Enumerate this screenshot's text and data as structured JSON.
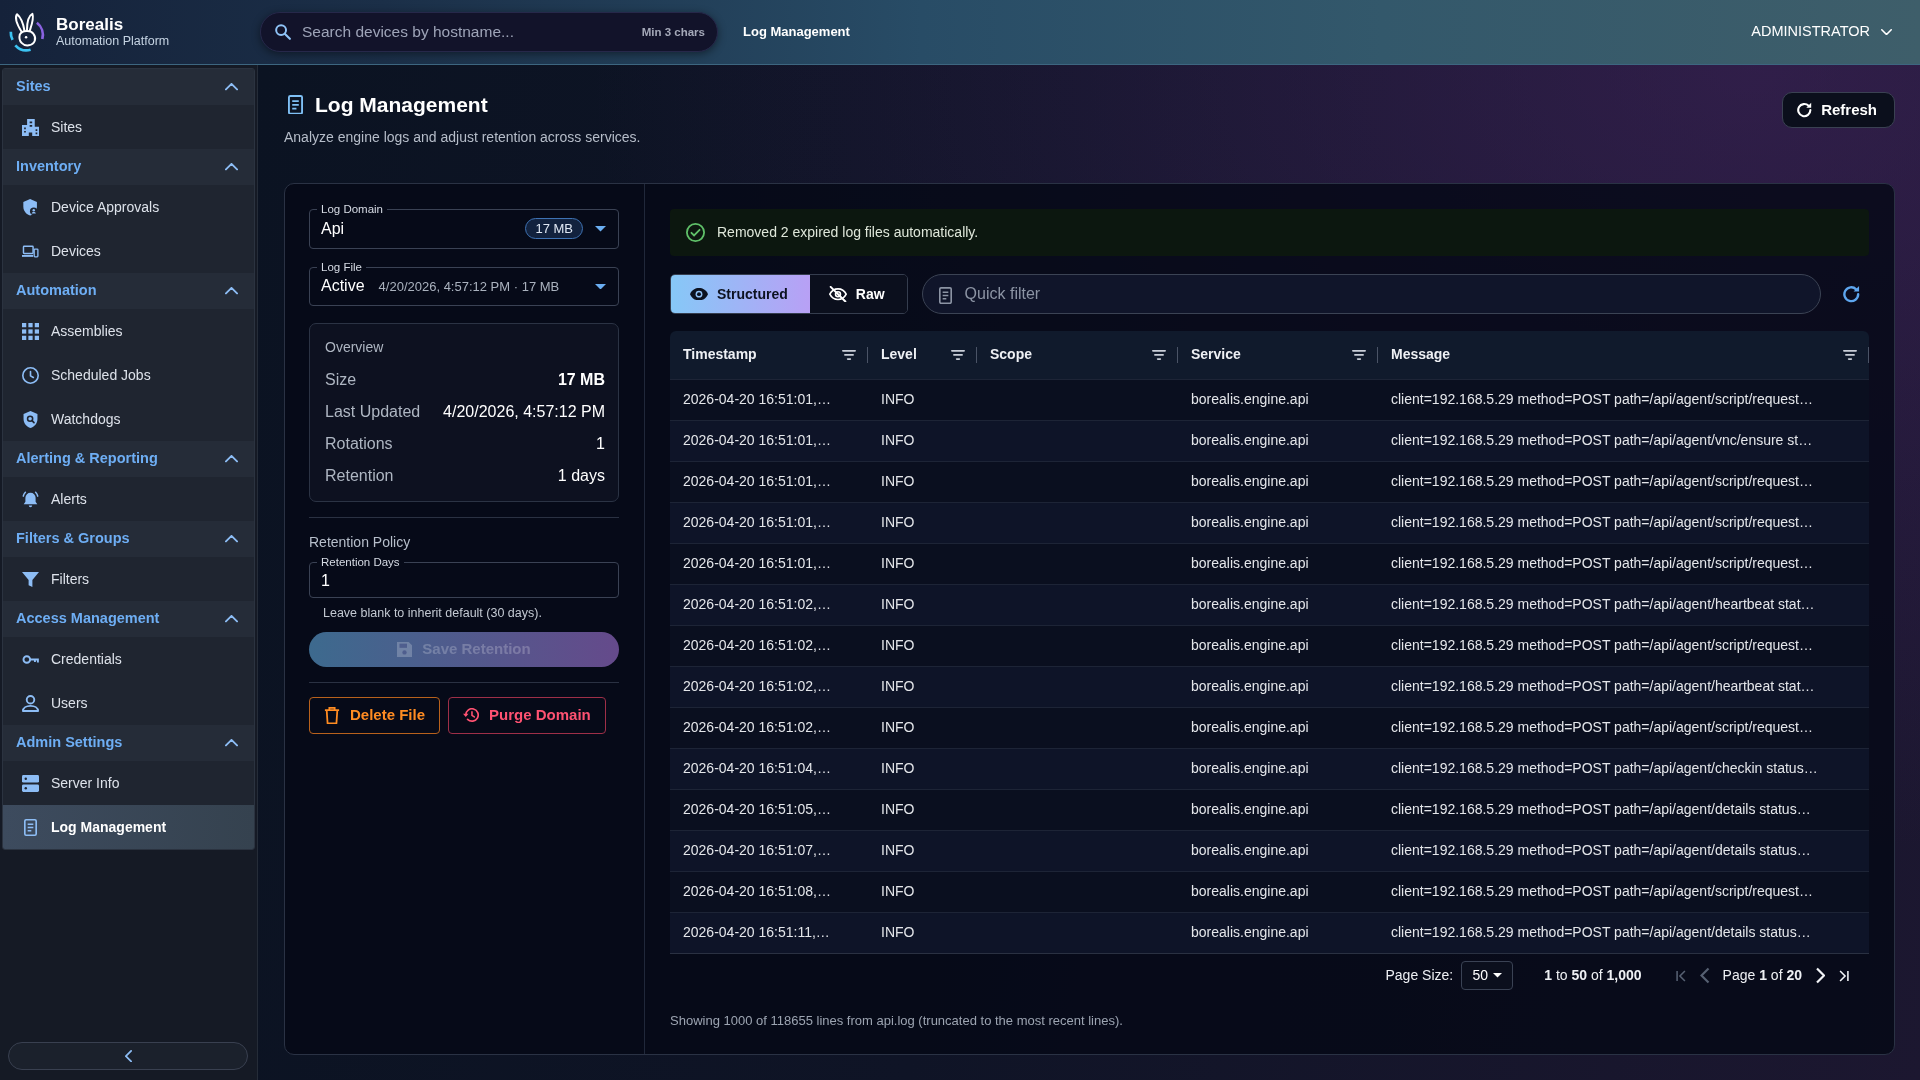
{
  "app": {
    "name": "Borealis",
    "tagline": "Automation Platform"
  },
  "search": {
    "placeholder": "Search devices by hostname...",
    "hint": "Min 3 chars"
  },
  "breadcrumb": "Log Management",
  "user_menu": "ADMINISTRATOR",
  "sidebar": {
    "sections": [
      {
        "title": "Sites",
        "expanded": true,
        "items": [
          {
            "label": "Sites",
            "selected": false
          }
        ]
      },
      {
        "title": "Inventory",
        "expanded": true,
        "items": [
          {
            "label": "Device Approvals",
            "selected": false
          },
          {
            "label": "Devices",
            "selected": false
          }
        ]
      },
      {
        "title": "Automation",
        "expanded": true,
        "items": [
          {
            "label": "Assemblies",
            "selected": false
          },
          {
            "label": "Scheduled Jobs",
            "selected": false
          },
          {
            "label": "Watchdogs",
            "selected": false
          }
        ]
      },
      {
        "title": "Alerting & Reporting",
        "expanded": true,
        "items": [
          {
            "label": "Alerts",
            "selected": false
          }
        ]
      },
      {
        "title": "Filters & Groups",
        "expanded": true,
        "items": [
          {
            "label": "Filters",
            "selected": false
          }
        ]
      },
      {
        "title": "Access Management",
        "expanded": true,
        "items": [
          {
            "label": "Credentials",
            "selected": false
          },
          {
            "label": "Users",
            "selected": false
          }
        ]
      },
      {
        "title": "Admin Settings",
        "expanded": true,
        "items": [
          {
            "label": "Server Info",
            "selected": false
          },
          {
            "label": "Log Management",
            "selected": true
          }
        ]
      }
    ]
  },
  "page": {
    "title": "Log Management",
    "subtitle": "Analyze engine logs and adjust retention across services.",
    "refresh_button": "Refresh"
  },
  "log_domain": {
    "label": "Log Domain",
    "value": "Api",
    "badge": "17 MB"
  },
  "log_file": {
    "label": "Log File",
    "value": "Active",
    "detail": "4/20/2026, 4:57:12 PM · 17 MB"
  },
  "overview": {
    "title": "Overview",
    "rows": [
      {
        "label": "Size",
        "value": "17 MB",
        "emphasized": true
      },
      {
        "label": "Last Updated",
        "value": "4/20/2026, 4:57:12 PM",
        "emphasized": false
      },
      {
        "label": "Rotations",
        "value": "1",
        "emphasized": false
      },
      {
        "label": "Retention",
        "value": "1 days",
        "emphasized": false
      }
    ]
  },
  "retention_policy": {
    "title": "Retention Policy",
    "field_label": "Retention Days",
    "value": "1",
    "help": "Leave blank to inherit default (30 days).",
    "save_button": {
      "label": "Save Retention",
      "disabled": true
    }
  },
  "file_actions": [
    {
      "label": "Delete File",
      "kind": "warning"
    },
    {
      "label": "Purge Domain",
      "kind": "danger"
    }
  ],
  "alert": {
    "kind": "success",
    "text": "Removed 2 expired log files automatically."
  },
  "view_modes": [
    {
      "label": "Structured",
      "selected": true
    },
    {
      "label": "Raw",
      "selected": false
    }
  ],
  "quick_filter": {
    "placeholder": "Quick filter"
  },
  "table": {
    "columns": [
      "Timestamp",
      "Level",
      "Scope",
      "Service",
      "Message"
    ],
    "rows": [
      {
        "timestamp": "2026-04-20 16:51:01,…",
        "level": "INFO",
        "service": "borealis.engine.api",
        "message": "client=192.168.5.29 method=POST path=/api/agent/script/request…"
      },
      {
        "timestamp": "2026-04-20 16:51:01,…",
        "level": "INFO",
        "service": "borealis.engine.api",
        "message": "client=192.168.5.29 method=POST path=/api/agent/vnc/ensure st…"
      },
      {
        "timestamp": "2026-04-20 16:51:01,…",
        "level": "INFO",
        "service": "borealis.engine.api",
        "message": "client=192.168.5.29 method=POST path=/api/agent/script/request…"
      },
      {
        "timestamp": "2026-04-20 16:51:01,…",
        "level": "INFO",
        "service": "borealis.engine.api",
        "message": "client=192.168.5.29 method=POST path=/api/agent/script/request…"
      },
      {
        "timestamp": "2026-04-20 16:51:01,…",
        "level": "INFO",
        "service": "borealis.engine.api",
        "message": "client=192.168.5.29 method=POST path=/api/agent/script/request…"
      },
      {
        "timestamp": "2026-04-20 16:51:02,…",
        "level": "INFO",
        "service": "borealis.engine.api",
        "message": "client=192.168.5.29 method=POST path=/api/agent/heartbeat stat…"
      },
      {
        "timestamp": "2026-04-20 16:51:02,…",
        "level": "INFO",
        "service": "borealis.engine.api",
        "message": "client=192.168.5.29 method=POST path=/api/agent/script/request…"
      },
      {
        "timestamp": "2026-04-20 16:51:02,…",
        "level": "INFO",
        "service": "borealis.engine.api",
        "message": "client=192.168.5.29 method=POST path=/api/agent/heartbeat stat…"
      },
      {
        "timestamp": "2026-04-20 16:51:02,…",
        "level": "INFO",
        "service": "borealis.engine.api",
        "message": "client=192.168.5.29 method=POST path=/api/agent/script/request…"
      },
      {
        "timestamp": "2026-04-20 16:51:04,…",
        "level": "INFO",
        "service": "borealis.engine.api",
        "message": "client=192.168.5.29 method=POST path=/api/agent/checkin status…"
      },
      {
        "timestamp": "2026-04-20 16:51:05,…",
        "level": "INFO",
        "service": "borealis.engine.api",
        "message": "client=192.168.5.29 method=POST path=/api/agent/details status…"
      },
      {
        "timestamp": "2026-04-20 16:51:07,…",
        "level": "INFO",
        "service": "borealis.engine.api",
        "message": "client=192.168.5.29 method=POST path=/api/agent/details status…"
      },
      {
        "timestamp": "2026-04-20 16:51:08,…",
        "level": "INFO",
        "service": "borealis.engine.api",
        "message": "client=192.168.5.29 method=POST path=/api/agent/script/request…"
      },
      {
        "timestamp": "2026-04-20 16:51:11,…",
        "level": "INFO",
        "service": "borealis.engine.api",
        "message": "client=192.168.5.29 method=POST path=/api/agent/details status…"
      }
    ]
  },
  "pagination": {
    "page_size_label": "Page Size:",
    "page_size": "50",
    "range": "**1** to **50** of **1,000**",
    "page": "Page **1** of **20**",
    "controls": [
      {
        "kind": "first",
        "disabled": true
      },
      {
        "kind": "previous",
        "disabled": true
      },
      {
        "kind": "next",
        "disabled": false
      },
      {
        "kind": "last",
        "disabled": false
      }
    ]
  },
  "footer": "Showing 1000 of 118655 lines from api.log (truncated to the most recent lines)."
}
